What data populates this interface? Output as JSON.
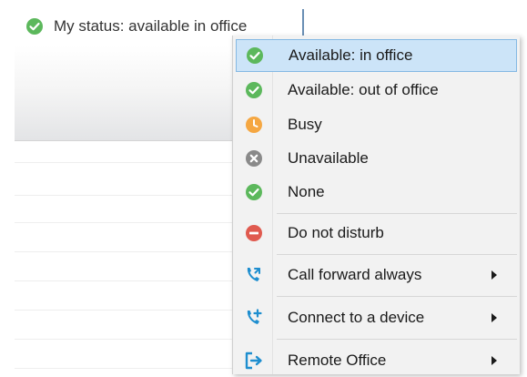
{
  "status_bar": {
    "text": "My status: available in office",
    "icon": "check-circle-icon",
    "icon_color": "#5cb85c"
  },
  "menu": {
    "items": [
      {
        "label": "Available: in office",
        "icon": "check-circle-icon",
        "icon_color": "#5cb85c",
        "selected": true,
        "submenu": false
      },
      {
        "label": "Available: out of office",
        "icon": "check-circle-icon",
        "icon_color": "#5cb85c",
        "selected": false,
        "submenu": false
      },
      {
        "label": "Busy",
        "icon": "clock-circle-icon",
        "icon_color": "#f5a742",
        "selected": false,
        "submenu": false
      },
      {
        "label": "Unavailable",
        "icon": "x-circle-icon",
        "icon_color": "#8a8a8a",
        "selected": false,
        "submenu": false
      },
      {
        "label": "None",
        "icon": "check-circle-icon",
        "icon_color": "#5cb85c",
        "selected": false,
        "submenu": false
      },
      {
        "label": "Do not disturb",
        "icon": "minus-circle-icon",
        "icon_color": "#e05a4f",
        "selected": false,
        "submenu": false
      },
      {
        "label": "Call forward always",
        "icon": "call-forward-icon",
        "icon_color": "#1e8ecf",
        "selected": false,
        "submenu": true
      },
      {
        "label": "Connect to a device",
        "icon": "phone-add-icon",
        "icon_color": "#1e8ecf",
        "selected": false,
        "submenu": true
      },
      {
        "label": "Remote Office",
        "icon": "remote-office-icon",
        "icon_color": "#1e8ecf",
        "selected": false,
        "submenu": true
      }
    ]
  },
  "colors": {
    "selection_bg": "#cce4f8",
    "selection_border": "#84b8e3",
    "menu_bg": "#f2f2f2"
  }
}
